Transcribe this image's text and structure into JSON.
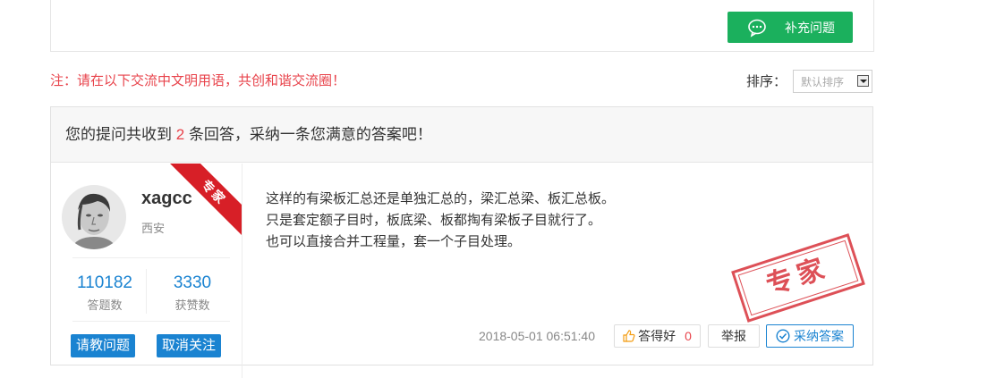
{
  "question_toolbar": {
    "supplement_label": "补充问题",
    "supplement_icon": "chat-bubble-icon"
  },
  "notice": "注：请在以下交流中文明用语，共创和谐交流圈！",
  "sort": {
    "label": "排序：",
    "selected": "默认排序"
  },
  "answers_header": {
    "prefix": "您的提问共收到",
    "count": "2",
    "suffix": "条回答，采纳一条您满意的答案吧！"
  },
  "answer": {
    "user": {
      "name": "xagcc",
      "location": "西安",
      "badge": "专家",
      "answers_count": "110182",
      "answers_label": "答题数",
      "likes_count": "3330",
      "likes_label": "获赞数",
      "ask_button": "请教问题",
      "unfollow_button": "取消关注"
    },
    "lines": [
      "这样的有梁板汇总还是单独汇总的，梁汇总梁、板汇总板。",
      "只是套定额子目时，板底梁、板都掏有梁板子目就行了。",
      "也可以直接合并工程量，套一个子目处理。"
    ],
    "stamp": "专家",
    "timestamp": "2018-05-01 06:51:40",
    "like_label": "答得好",
    "like_count": "0",
    "report_label": "举报",
    "accept_label": "采纳答案"
  },
  "colors": {
    "green": "#1bb05d",
    "blue": "#1a83d1",
    "red": "#e8434b"
  }
}
